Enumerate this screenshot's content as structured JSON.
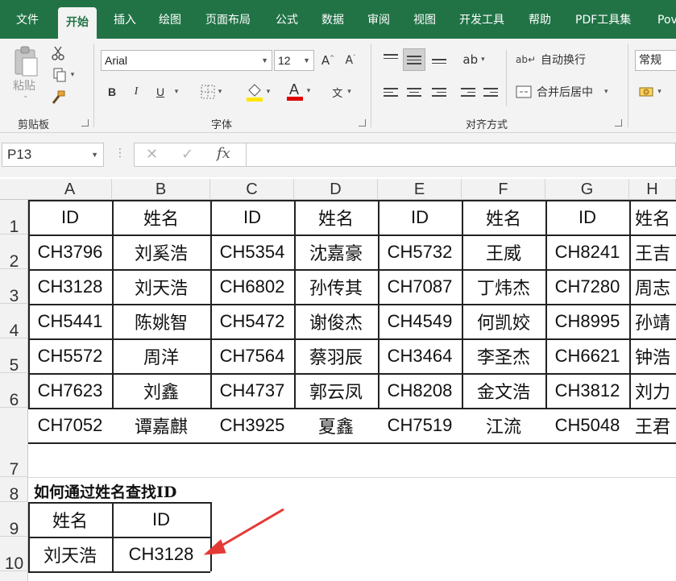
{
  "menu": {
    "tabs": [
      "文件",
      "开始",
      "插入",
      "绘图",
      "页面布局",
      "公式",
      "数据",
      "审阅",
      "视图",
      "开发工具",
      "帮助",
      "PDF工具集",
      "Pov"
    ],
    "active": "开始"
  },
  "ribbon": {
    "clipboard": {
      "paste_label": "粘贴",
      "group_label": "剪贴板"
    },
    "font": {
      "name": "Arial",
      "size": "12",
      "bold": "B",
      "italic": "I",
      "underline": "U",
      "group_label": "字体",
      "font_color": "#e00000",
      "fill_color": "#ffe600"
    },
    "alignment": {
      "wrap_text": "自动换行",
      "merge_center": "合并后居中",
      "group_label": "对齐方式"
    },
    "number": {
      "format": "常规"
    }
  },
  "formula_bar": {
    "name_box": "P13",
    "formula": ""
  },
  "sheet": {
    "columns": [
      "A",
      "B",
      "C",
      "D",
      "E",
      "F",
      "G",
      "H"
    ],
    "row_numbers": [
      "1",
      "2",
      "3",
      "4",
      "5",
      "6",
      "7",
      "8",
      "9",
      "10"
    ],
    "table_header": [
      "ID",
      "姓名",
      "ID",
      "姓名",
      "ID",
      "姓名",
      "ID",
      "姓名"
    ],
    "table_rows": [
      [
        "CH3796",
        "刘奚浩",
        "CH5354",
        "沈嘉豪",
        "CH5732",
        "王威",
        "CH8241",
        "王吉"
      ],
      [
        "CH3128",
        "刘天浩",
        "CH6802",
        "孙传其",
        "CH7087",
        "丁炜杰",
        "CH7280",
        "周志"
      ],
      [
        "CH5441",
        "陈姚智",
        "CH5472",
        "谢俊杰",
        "CH4549",
        "何凯姣",
        "CH8995",
        "孙靖"
      ],
      [
        "CH5572",
        "周洋",
        "CH7564",
        "蔡羽辰",
        "CH3464",
        "李圣杰",
        "CH6621",
        "钟浩"
      ],
      [
        "CH7623",
        "刘鑫",
        "CH4737",
        "郭云凤",
        "CH8208",
        "金文浩",
        "CH3812",
        "刘力"
      ],
      [
        "CH7052",
        "谭嘉麒",
        "CH3925",
        "夏鑫",
        "CH7519",
        "江流",
        "CH5048",
        "王君"
      ]
    ],
    "lookup_title": "如何通过姓名查找ID",
    "lookup_header": [
      "姓名",
      "ID"
    ],
    "lookup_values": [
      "刘天浩",
      "CH3128"
    ],
    "annotation_color": "#e53935"
  }
}
